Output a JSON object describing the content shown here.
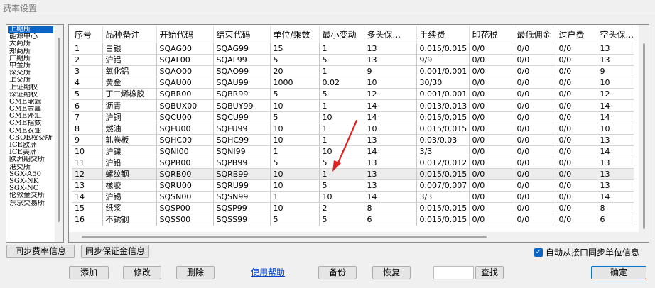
{
  "window": {
    "title": "费率设置"
  },
  "exchanges": {
    "selected_index": 0,
    "items": [
      "上期所",
      "能源中心",
      "大商所",
      "郑商所",
      "广期所",
      "中金所",
      "深交所",
      "上交所",
      "上证期权",
      "深证期权",
      "CME能源",
      "CME金属",
      "CME外汇",
      "CME指数",
      "CME农业",
      "CBOE权交所",
      "ICE欧洲",
      "ICE美洲",
      "欧洲期交所",
      "港交所",
      "SGX-A50",
      "SGX-NK",
      "SGX-NC",
      "伦敦金交所",
      "东京交易所"
    ]
  },
  "table": {
    "columns": [
      "序号",
      "品种备注",
      "开始代码",
      "结束代码",
      "单位/乘数",
      "最小变动",
      "多头保...",
      "手续费",
      "印花税",
      "最低佣金",
      "过户费",
      "空头保..."
    ],
    "highlighted_row": 11,
    "rows": [
      [
        "1",
        "白银",
        "SQAG00",
        "SQAG99",
        "15",
        "1",
        "13",
        "0.015/0.015",
        "0/0",
        "0/0",
        "0/0",
        "13"
      ],
      [
        "2",
        "沪铝",
        "SQAL00",
        "SQAL99",
        "5",
        "5",
        "13",
        "9/9",
        "0/0",
        "0/0",
        "0/0",
        "13"
      ],
      [
        "3",
        "氧化铝",
        "SQAO00",
        "SQAO99",
        "20",
        "1",
        "9",
        "0.001/0.001",
        "0/0",
        "0/0",
        "0/0",
        "9"
      ],
      [
        "4",
        "黄金",
        "SQAU00",
        "SQAU99",
        "1000",
        "0.02",
        "10",
        "30/30",
        "0/0",
        "0/0",
        "0/0",
        "10"
      ],
      [
        "5",
        "丁二烯橡胶",
        "SQBR00",
        "SQBR99",
        "5",
        "5",
        "12",
        "0.001/0.001",
        "0/0",
        "0/0",
        "0/0",
        "12"
      ],
      [
        "6",
        "沥青",
        "SQBUX00",
        "SQBUY99",
        "10",
        "1",
        "14",
        "0.013/0.013",
        "0/0",
        "0/0",
        "0/0",
        "14"
      ],
      [
        "7",
        "沪铜",
        "SQCU00",
        "SQCU99",
        "5",
        "10",
        "14",
        "0.015/0.015",
        "0/0",
        "0/0",
        "0/0",
        "14"
      ],
      [
        "8",
        "燃油",
        "SQFU00",
        "SQFU99",
        "10",
        "1",
        "10",
        "0.015/0.015",
        "0/0",
        "0/0",
        "0/0",
        "10"
      ],
      [
        "9",
        "轧卷板",
        "SQHC00",
        "SQHC99",
        "10",
        "1",
        "13",
        "0.03/0.03",
        "0/0",
        "0/0",
        "0/0",
        "13"
      ],
      [
        "10",
        "沪镍",
        "SQNI00",
        "SQNI99",
        "1",
        "10",
        "14",
        "3/3",
        "0/0",
        "0/0",
        "0/0",
        "14"
      ],
      [
        "11",
        "沪铅",
        "SQPB00",
        "SQPB99",
        "5",
        "5",
        "13",
        "0.012/0.012",
        "0/0",
        "0/0",
        "0/0",
        "13"
      ],
      [
        "12",
        "螺纹钢",
        "SQRB00",
        "SQRB99",
        "10",
        "1",
        "13",
        "0.015/0.015",
        "0/0",
        "0/0",
        "0/0",
        "13"
      ],
      [
        "13",
        "橡胶",
        "SQRU00",
        "SQRU99",
        "10",
        "5",
        "13",
        "0.007/0.007",
        "0/0",
        "0/0",
        "0/0",
        "13"
      ],
      [
        "14",
        "沪锡",
        "SQSN00",
        "SQSN99",
        "1",
        "10",
        "14",
        "3/3",
        "0/0",
        "0/0",
        "0/0",
        "14"
      ],
      [
        "15",
        "纸浆",
        "SQSP00",
        "SQSP99",
        "10",
        "2",
        "8",
        "0.015/0.015",
        "0/0",
        "0/0",
        "0/0",
        "8"
      ],
      [
        "16",
        "不锈钢",
        "SQSS00",
        "SQSS99",
        "5",
        "5",
        "6",
        "0.015/0.015",
        "0/0",
        "0/0",
        "0/0",
        "6"
      ]
    ]
  },
  "buttons": {
    "sync_fee": "同步费率信息",
    "sync_margin": "同步保证金信息",
    "add": "添加",
    "modify": "修改",
    "delete": "删除",
    "help": "使用帮助",
    "backup": "备份",
    "restore": "恢复",
    "search": "查找",
    "ok": "确定"
  },
  "auto_sync": {
    "label": "自动从接口同步单位信息",
    "checked": true
  },
  "colors": {
    "selection": "#0a64c8",
    "arrow": "#e02020",
    "link": "#0044cc"
  }
}
